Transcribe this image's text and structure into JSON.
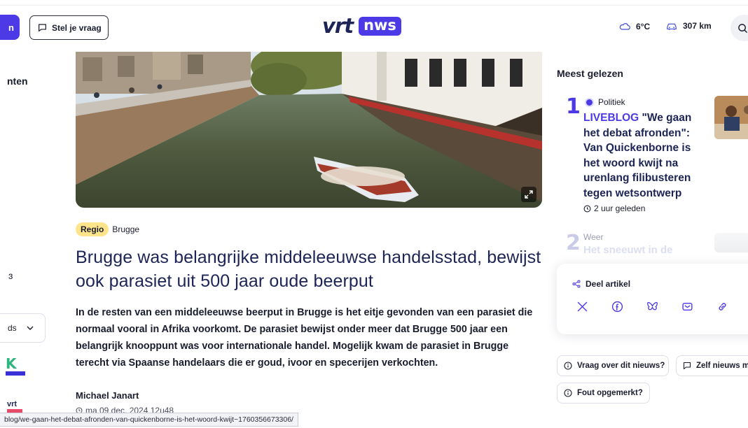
{
  "header": {
    "ask_label": "Stel je vraag",
    "logo_left": "vrt",
    "logo_right": "nws",
    "temperature": "6°C",
    "traffic": "307 km"
  },
  "sidebar": {
    "cut_item_1": "nten",
    "cut_item_2": "ɜ",
    "dropdown_label": "ds",
    "k_logo": "K",
    "vrt_logo": "vrt"
  },
  "article": {
    "tag_region": "Regio",
    "tag_city": "Brugge",
    "headline": "Brugge was belangrijke middeleeuwse handelsstad, bewijst ook parasiet uit 500 jaar oude beerput",
    "lead": "In de resten van een middeleeuwse beerput in Brugge is het eitje gevonden van een parasiet die normaal vooral in Afrika voorkomt. De parasiet bewijst onder meer dat Brugge 500 jaar een belangrijk knooppunt was voor internationale handel. Mogelijk kwam de parasiet in Brugge terecht via Spaanse handelaars die er goud, ivoor en specerijen verkochten.",
    "author": "Michael Janart",
    "date": "ma 09 dec. 2024 12u48"
  },
  "most_read": {
    "title": "Meest gelezen",
    "items": [
      {
        "rank": "1",
        "category": "Politiek",
        "live_label": "LIVEBLOG",
        "title": "\"We gaan het debat afronden\": Van Quickenborne is het woord kwijt na urenlang filibusteren tegen wetsontwerp",
        "time": "2 uur geleden"
      },
      {
        "rank": "2",
        "category": "Weer",
        "title": "Het sneeuwt in de"
      }
    ]
  },
  "share": {
    "title": "Deel artikel",
    "icons": [
      "x-icon",
      "facebook-icon",
      "bluesky-icon",
      "mail-icon",
      "link-icon"
    ]
  },
  "actions": {
    "question": "Vraag over dit nieuws?",
    "submit_news": "Zelf nieuws m",
    "report_error": "Fout opgemerkt?"
  },
  "status_bar": {
    "url": "blog/we-gaan-het-debat-afronden-van-quickenborne-is-het-woord-kwijt~1760356673306/"
  },
  "colors": {
    "accent": "#4b3ae6",
    "navy": "#1d2456",
    "regio_tag": "#ffe58a"
  }
}
